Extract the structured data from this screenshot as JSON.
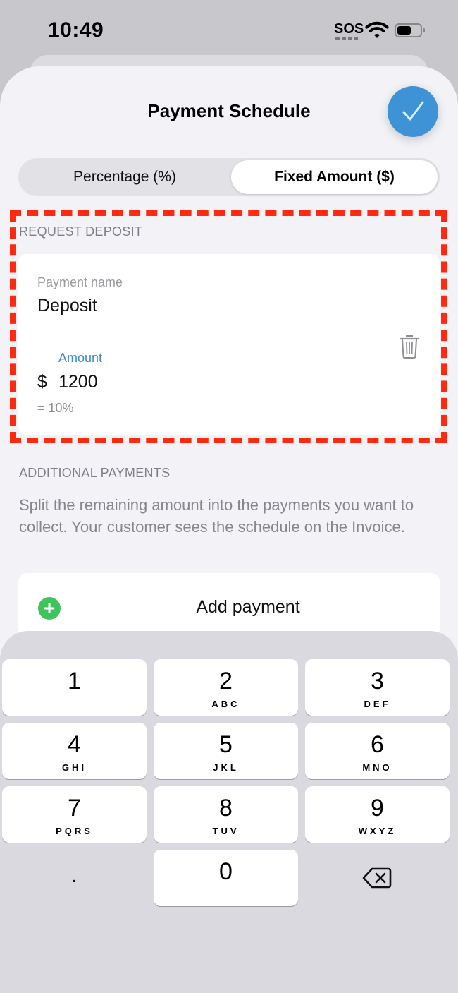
{
  "status_bar": {
    "time": "10:49",
    "carrier": "SOS",
    "icons": [
      "wifi-icon",
      "battery-icon"
    ]
  },
  "header": {
    "title": "Payment Schedule",
    "done_icon": "checkmark-icon",
    "done_color": "#3d93d6"
  },
  "segmented_control": {
    "options": [
      "Percentage (%)",
      "Fixed Amount ($)"
    ],
    "selected": "Fixed Amount ($)"
  },
  "request_deposit": {
    "section_label": "REQUEST DEPOSIT",
    "payment_name_label": "Payment name",
    "payment_name_value": "Deposit",
    "amount_label": "Amount",
    "currency_symbol": "$",
    "amount_value": "1200",
    "percent_equivalent": "= 10%",
    "delete_icon": "trash-icon"
  },
  "additional_payments": {
    "section_label": "ADDITIONAL PAYMENTS",
    "description": "Split the remaining amount into the payments you want to collect. Your customer sees the schedule on the Invoice.",
    "add_label": "Add payment",
    "add_icon": "plus-circle-icon",
    "add_icon_color": "#3ec45b"
  },
  "keypad": {
    "keys": [
      {
        "digit": "1",
        "letters": ""
      },
      {
        "digit": "2",
        "letters": "ABC"
      },
      {
        "digit": "3",
        "letters": "DEF"
      },
      {
        "digit": "4",
        "letters": "GHI"
      },
      {
        "digit": "5",
        "letters": "JKL"
      },
      {
        "digit": "6",
        "letters": "MNO"
      },
      {
        "digit": "7",
        "letters": "PQRS"
      },
      {
        "digit": "8",
        "letters": "TUV"
      },
      {
        "digit": "9",
        "letters": "WXYZ"
      },
      {
        "digit": ".",
        "letters": ""
      },
      {
        "digit": "0",
        "letters": ""
      },
      {
        "digit": "",
        "letters": ""
      }
    ],
    "delete_icon": "backspace-icon"
  },
  "highlight_color": "#ff2a0f"
}
